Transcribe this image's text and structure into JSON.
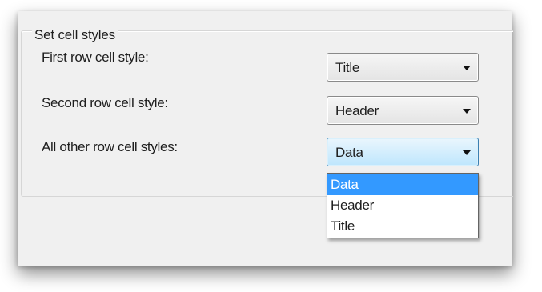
{
  "group": {
    "title": "Set cell styles"
  },
  "rows": [
    {
      "label": "First row cell style:",
      "value": "Title"
    },
    {
      "label": "Second row cell style:",
      "value": "Header"
    },
    {
      "label": "All other row cell styles:",
      "value": "Data"
    }
  ],
  "dropdown": {
    "options": [
      "Data",
      "Header",
      "Title"
    ],
    "selected": "Data"
  },
  "icons": {
    "combo_arrow": "chevron-down-icon"
  },
  "colors": {
    "selection": "#3399ff",
    "focus_border": "#3c7fb1"
  }
}
